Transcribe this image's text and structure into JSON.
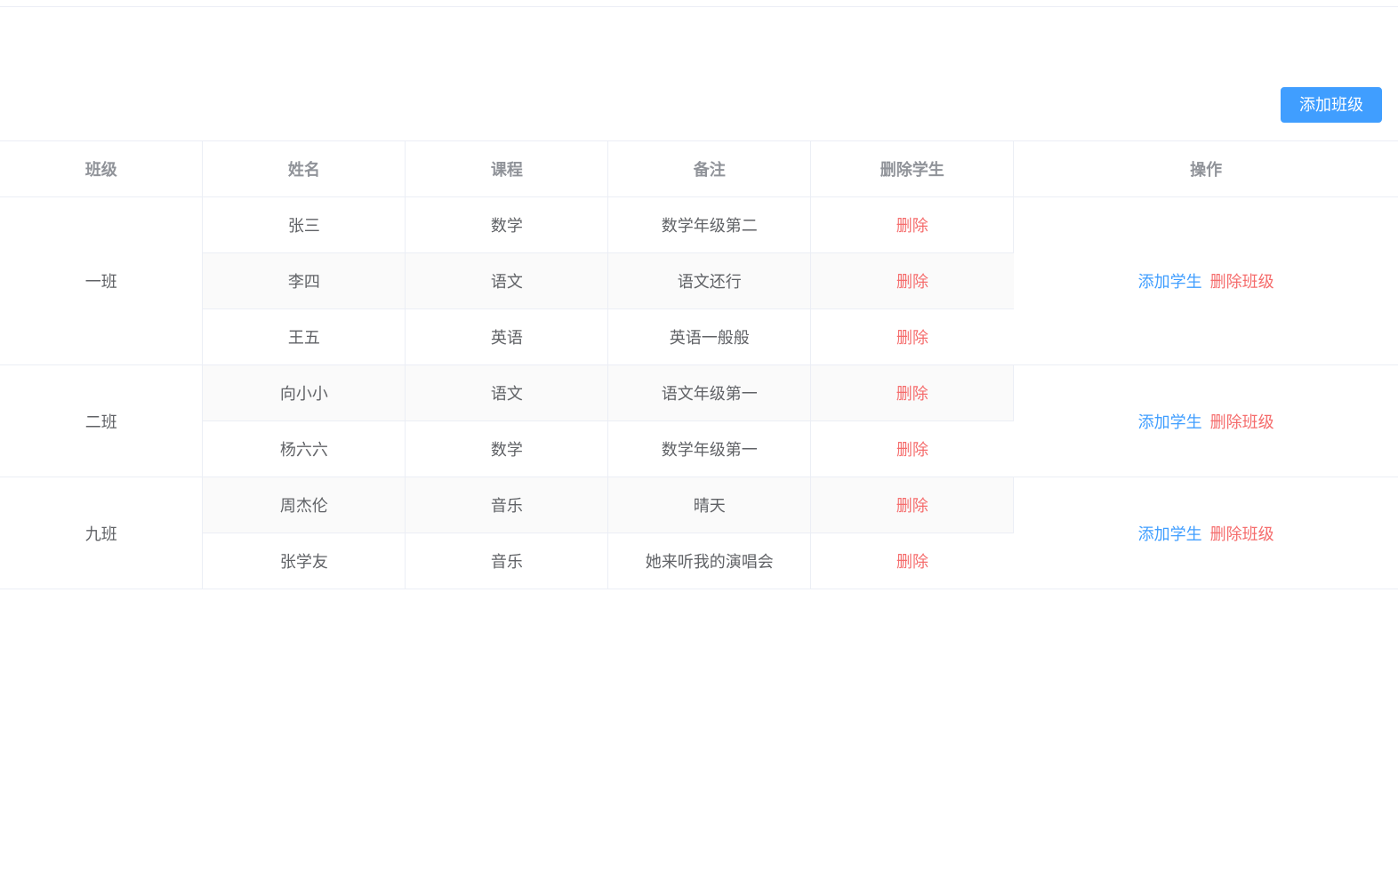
{
  "toolbar": {
    "add_class_label": "添加班级"
  },
  "table": {
    "headers": {
      "class": "班级",
      "name": "姓名",
      "course": "课程",
      "remark": "备注",
      "delete_student": "删除学生",
      "operation": "操作"
    },
    "delete_label": "删除",
    "add_student_label": "添加学生",
    "delete_class_label": "删除班级",
    "rows": [
      {
        "class_name": "一班",
        "students": [
          {
            "name": "张三",
            "course": "数学",
            "remark": "数学年级第二"
          },
          {
            "name": "李四",
            "course": "语文",
            "remark": "语文还行"
          },
          {
            "name": "王五",
            "course": "英语",
            "remark": "英语一般般"
          }
        ]
      },
      {
        "class_name": "二班",
        "students": [
          {
            "name": "向小小",
            "course": "语文",
            "remark": "语文年级第一"
          },
          {
            "name": "杨六六",
            "course": "数学",
            "remark": "数学年级第一"
          }
        ]
      },
      {
        "class_name": "九班",
        "students": [
          {
            "name": "周杰伦",
            "course": "音乐",
            "remark": "晴天"
          },
          {
            "name": "张学友",
            "course": "音乐",
            "remark": "她来听我的演唱会"
          }
        ]
      }
    ]
  }
}
